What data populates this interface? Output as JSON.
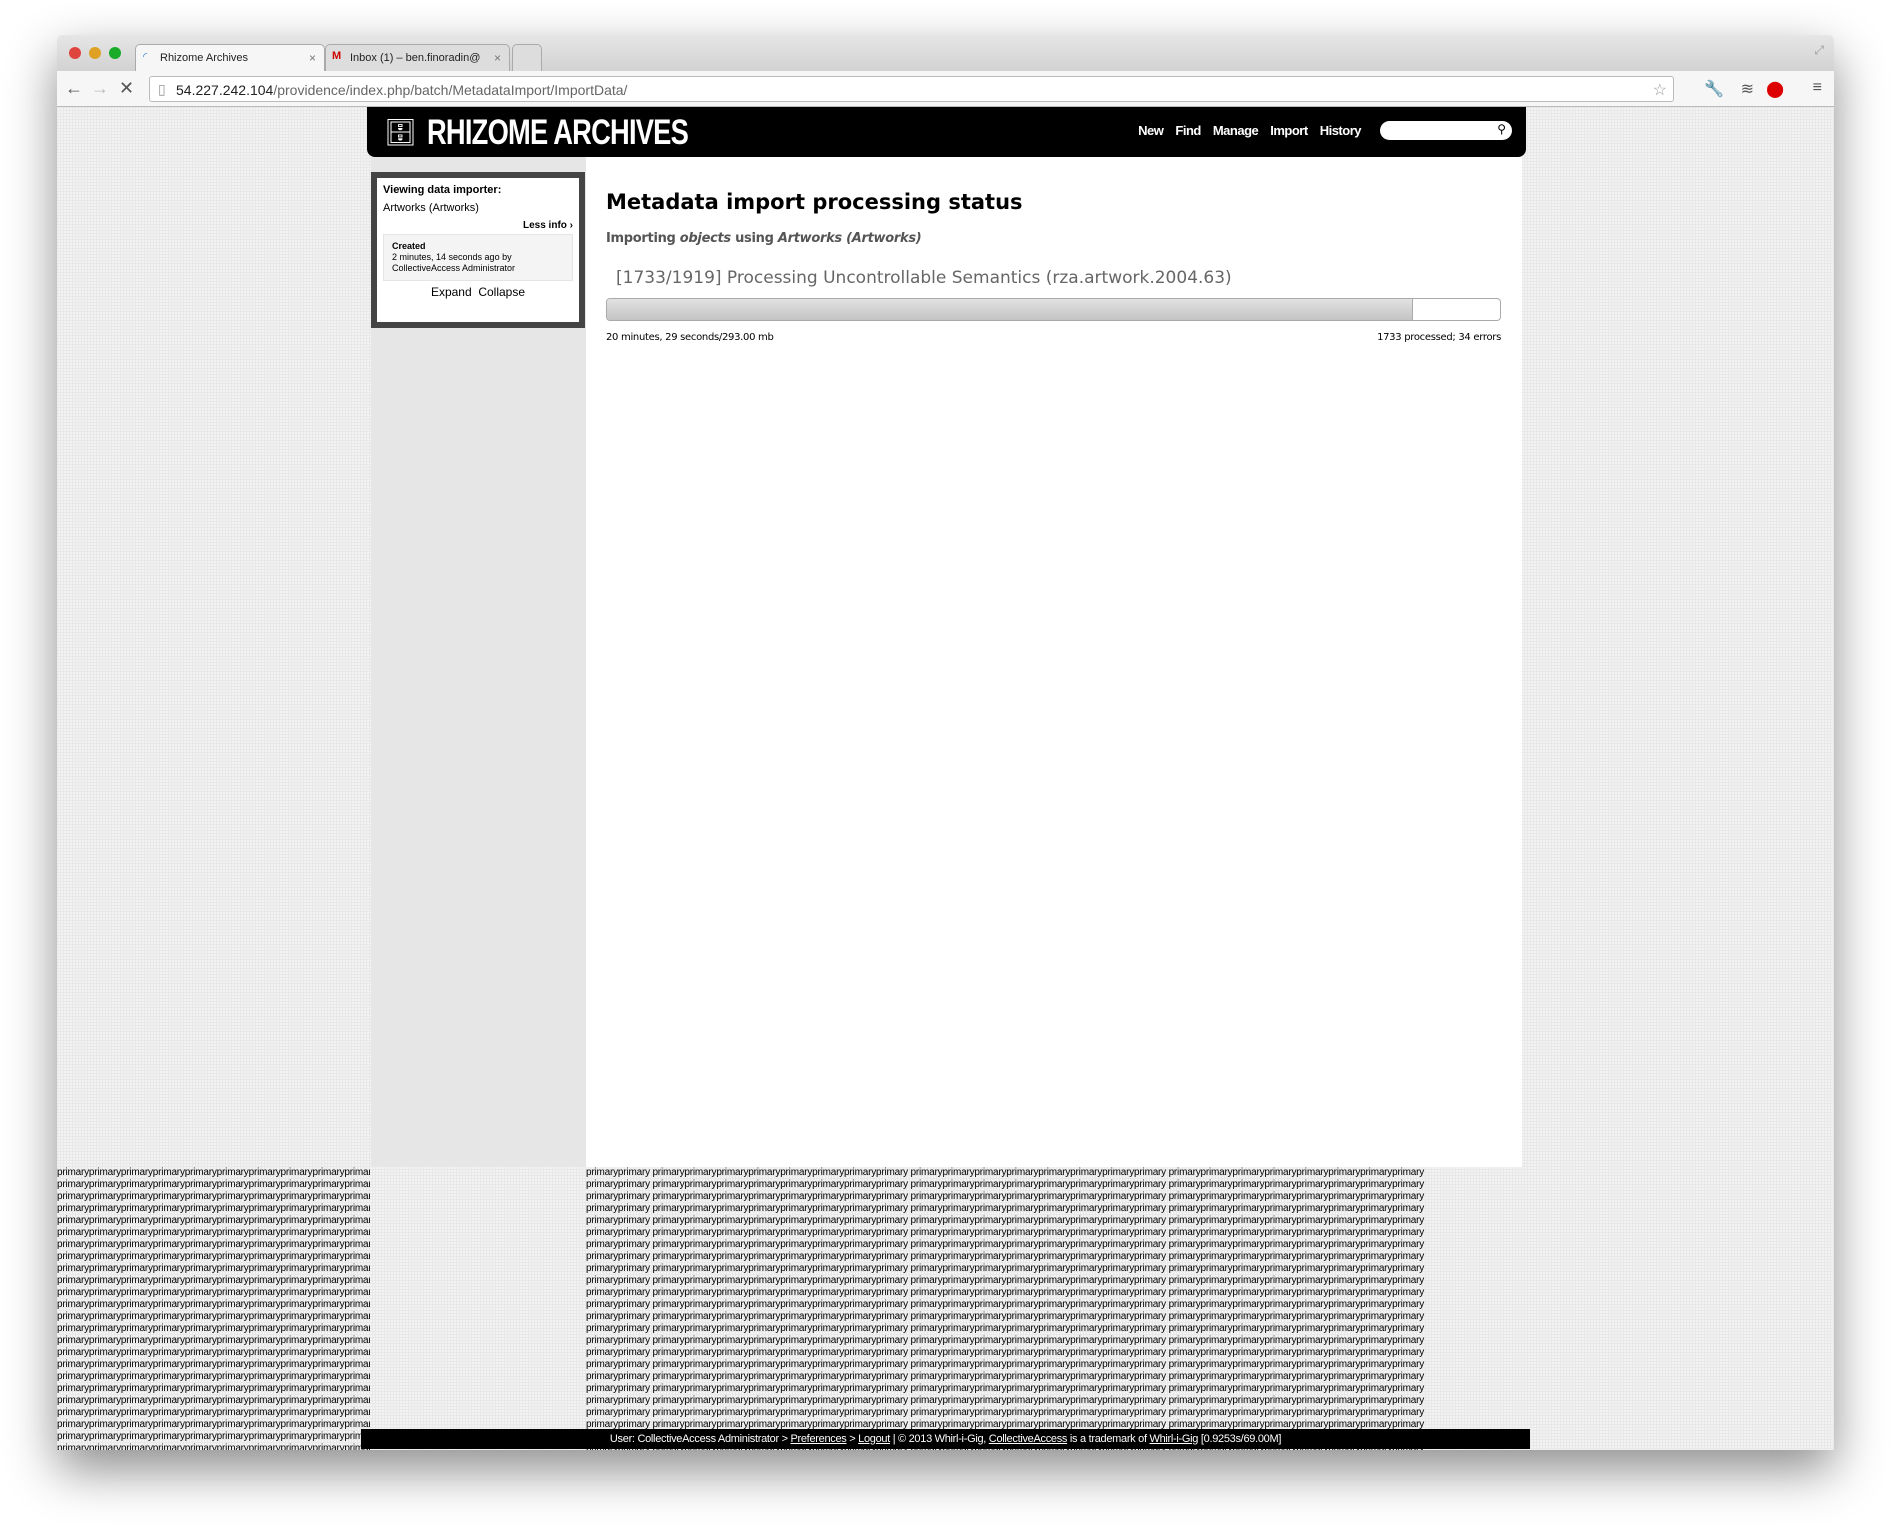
{
  "browser": {
    "tabs": [
      {
        "label": "Rhizome Archives",
        "icon": "loading-spinner-icon"
      },
      {
        "label": "Inbox (1) – ben.finoradin@",
        "icon": "gmail-icon"
      }
    ],
    "url_host": "54.227.242.104",
    "url_path": "/providence/index.php/batch/MetadataImport/ImportData/"
  },
  "header": {
    "logo": "RHIZOME ARCHIVES",
    "nav": [
      "New",
      "Find",
      "Manage",
      "Import",
      "History"
    ],
    "search_placeholder": ""
  },
  "sidebar": {
    "heading": "Viewing data importer:",
    "importer": "Artworks (Artworks)",
    "less_info": "Less info ›",
    "created_label": "Created",
    "created_value": "2 minutes, 14 seconds ago by CollectiveAccess Administrator",
    "expand": "Expand",
    "collapse": "Collapse"
  },
  "main": {
    "title": "Metadata import processing status",
    "subtitle_prefix": "Importing ",
    "subtitle_type": "objects",
    "subtitle_mid": " using ",
    "subtitle_importer": "Artworks (Artworks)",
    "status_line": "[1733/1919] Processing Uncontrollable Semantics (rza.artwork.2004.63)",
    "progress": {
      "processed": 1733,
      "total": 1919
    },
    "elapsed": "20 minutes, 29 seconds/293.00 mb",
    "counts": "1733 processed; 34 errors"
  },
  "debug_text": "primary",
  "footer": {
    "user": "User: CollectiveAccess Administrator > ",
    "preferences": "Preferences",
    "sep1": " > ",
    "logout": "Logout",
    "copyright": "  |  © 2013 Whirl-i-Gig, ",
    "ca": "CollectiveAccess",
    "trademark": " is a trademark of ",
    "wig": "Whirl-i-Gig",
    "stats": " [0.9253s/69.00M]"
  },
  "colors": {
    "header": "#000000",
    "progress_fill": "#c8c8c8",
    "sidebar_border": "#444444"
  }
}
